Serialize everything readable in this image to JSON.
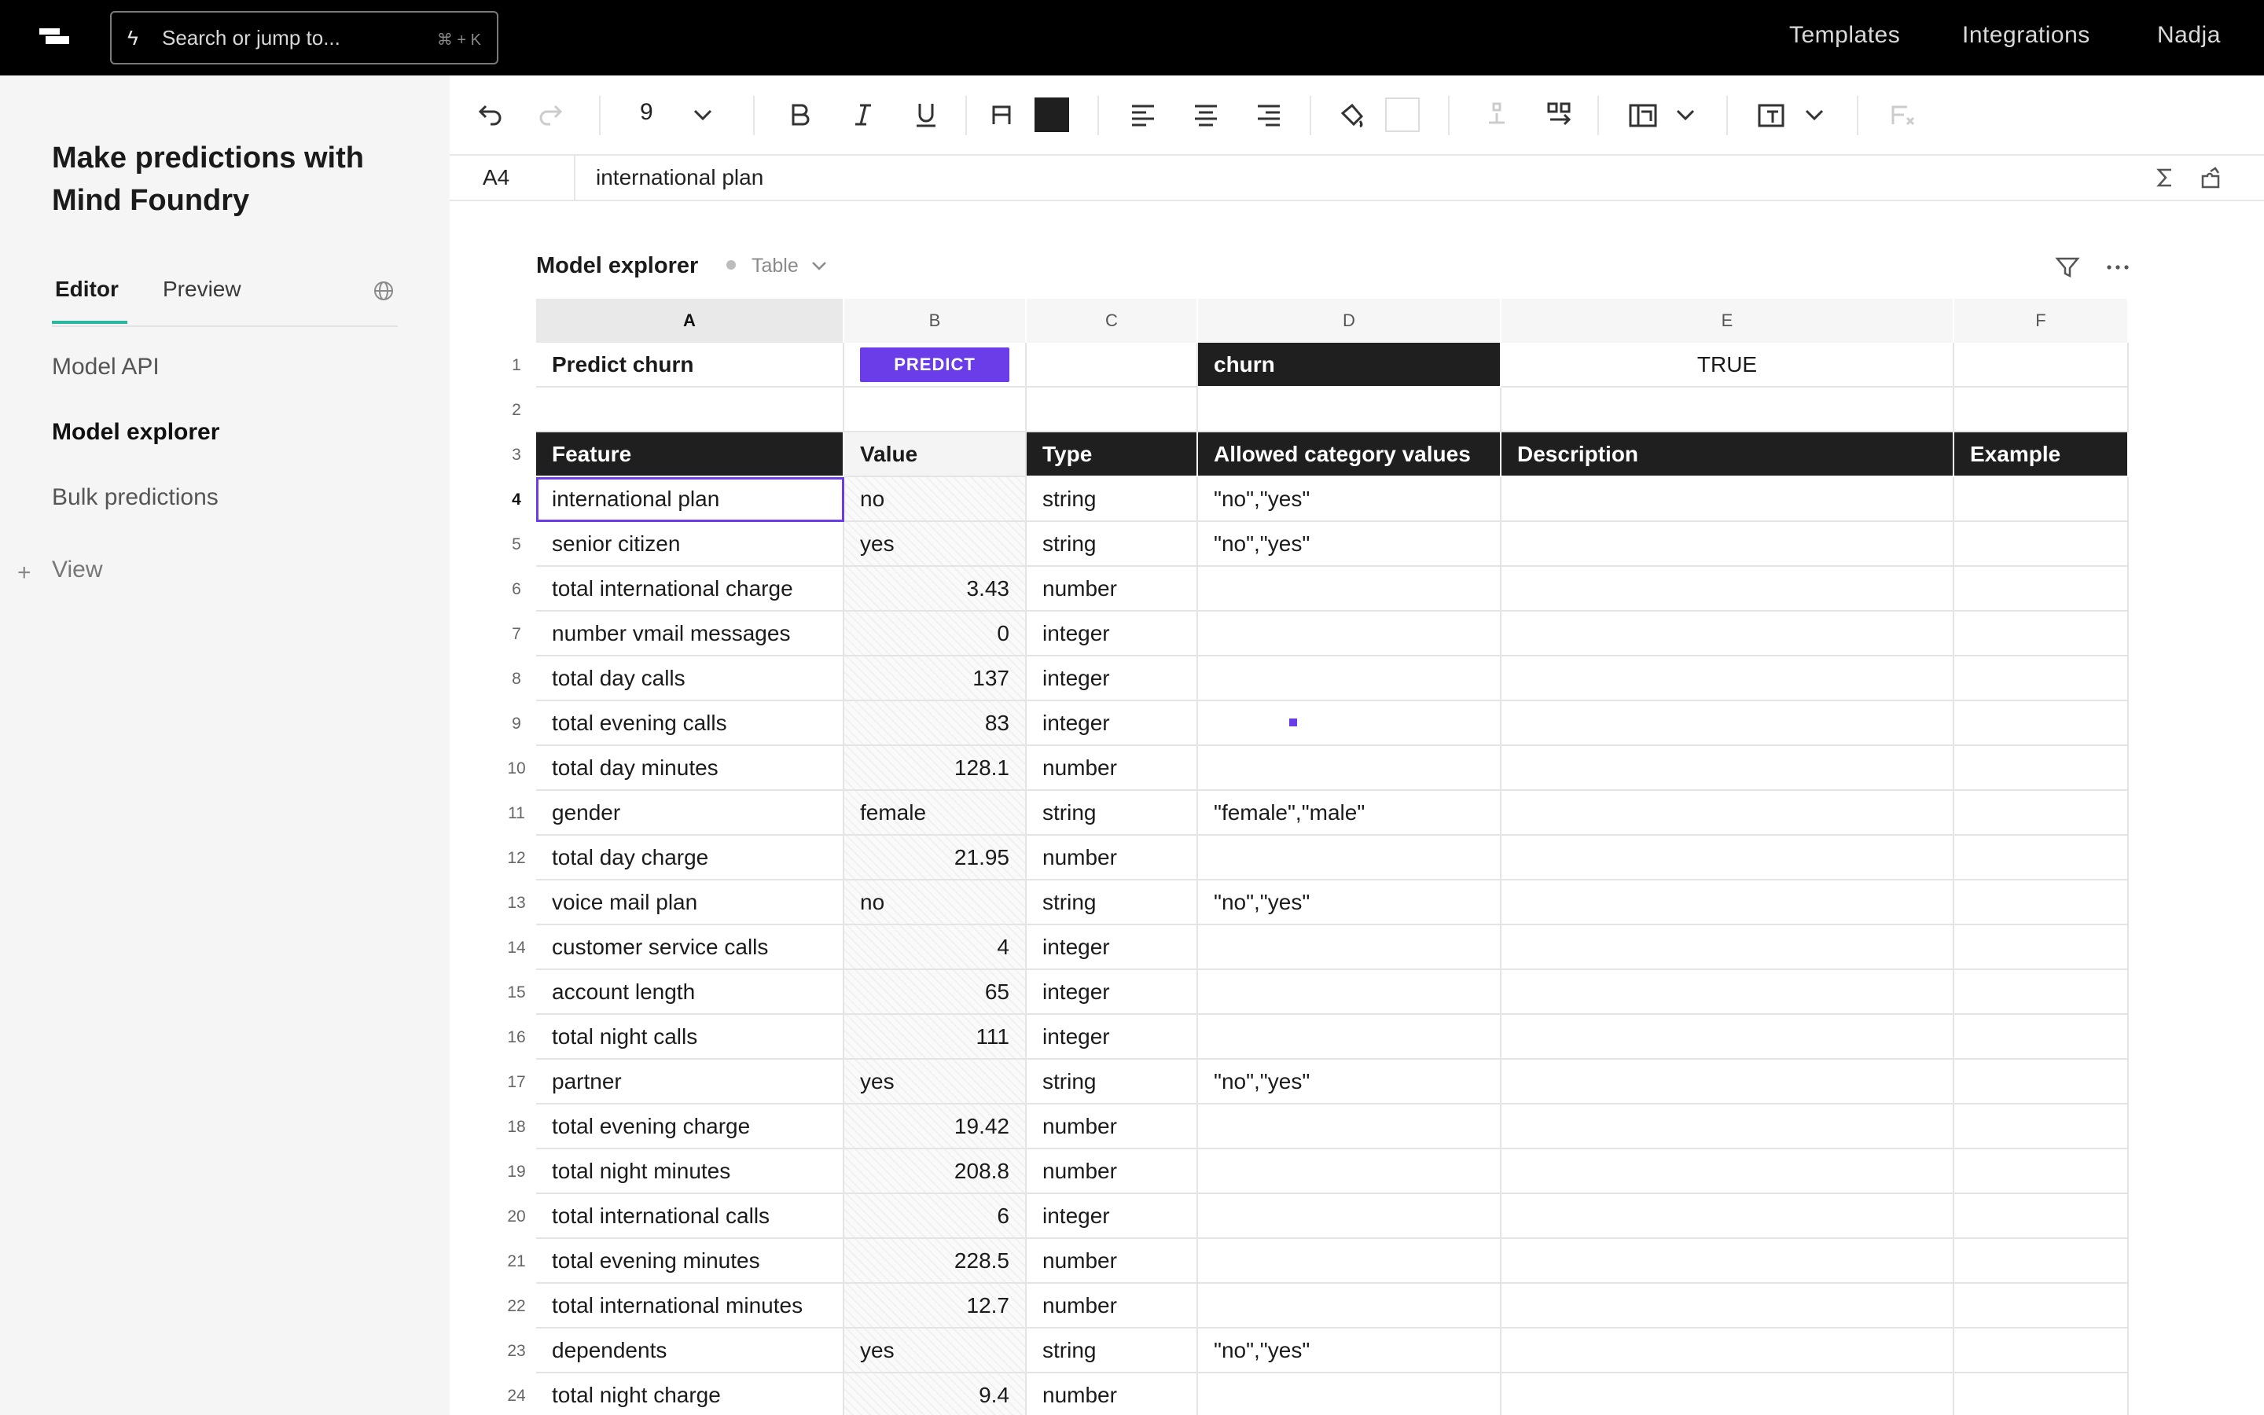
{
  "topbar": {
    "search_placeholder": "Search or jump to...",
    "search_shortcut": "⌘ + K",
    "links": [
      "Templates",
      "Integrations",
      "Nadja"
    ]
  },
  "sidebar": {
    "doc_title": "Make predictions with Mind Foundry",
    "tabs": {
      "editor": "Editor",
      "preview": "Preview"
    },
    "items": [
      {
        "label": "Model API",
        "active": false
      },
      {
        "label": "Model explorer",
        "active": true
      },
      {
        "label": "Bulk predictions",
        "active": false
      }
    ],
    "add_view_label": "View",
    "accent": "#2bb69e"
  },
  "toolbar": {
    "font_size": "9",
    "icons": [
      "undo-icon",
      "redo-icon",
      "font-size-dropdown-icon",
      "bold-icon",
      "italic-icon",
      "underline-icon",
      "text-color-icon",
      "text-color-swatch",
      "align-left-icon",
      "align-center-icon",
      "align-right-icon",
      "fill-color-icon",
      "fill-color-swatch",
      "insert-row-icon",
      "insert-column-icon",
      "merge-cells-icon",
      "text-wrap-icon",
      "clear-format-icon"
    ]
  },
  "formula_bar": {
    "cell_ref": "A4",
    "content": "international plan"
  },
  "table": {
    "title": "Model explorer",
    "view_type": "Table",
    "columns": [
      "A",
      "B",
      "C",
      "D",
      "E",
      "F"
    ],
    "header_row": {
      "predict_label": "Predict churn",
      "predict_button": "PREDICT",
      "target_label": "churn",
      "target_value": "TRUE"
    },
    "field_headers": [
      "Feature",
      "Value",
      "Type",
      "Allowed category values",
      "Description",
      "Example"
    ],
    "rows": [
      {
        "n": "4",
        "feature": "international plan",
        "value": "no",
        "type": "string",
        "allowed": "\"no\",\"yes\"",
        "numeric": false
      },
      {
        "n": "5",
        "feature": "senior citizen",
        "value": "yes",
        "type": "string",
        "allowed": "\"no\",\"yes\"",
        "numeric": false
      },
      {
        "n": "6",
        "feature": "total international charge",
        "value": "3.43",
        "type": "number",
        "allowed": "",
        "numeric": true
      },
      {
        "n": "7",
        "feature": "number vmail messages",
        "value": "0",
        "type": "integer",
        "allowed": "",
        "numeric": true
      },
      {
        "n": "8",
        "feature": "total day calls",
        "value": "137",
        "type": "integer",
        "allowed": "",
        "numeric": true
      },
      {
        "n": "9",
        "feature": "total evening calls",
        "value": "83",
        "type": "integer",
        "allowed": "",
        "numeric": true
      },
      {
        "n": "10",
        "feature": "total day minutes",
        "value": "128.1",
        "type": "number",
        "allowed": "",
        "numeric": true
      },
      {
        "n": "11",
        "feature": "gender",
        "value": "female",
        "type": "string",
        "allowed": "\"female\",\"male\"",
        "numeric": false
      },
      {
        "n": "12",
        "feature": "total day charge",
        "value": "21.95",
        "type": "number",
        "allowed": "",
        "numeric": true
      },
      {
        "n": "13",
        "feature": "voice mail plan",
        "value": "no",
        "type": "string",
        "allowed": "\"no\",\"yes\"",
        "numeric": false
      },
      {
        "n": "14",
        "feature": "customer service calls",
        "value": "4",
        "type": "integer",
        "allowed": "",
        "numeric": true
      },
      {
        "n": "15",
        "feature": "account length",
        "value": "65",
        "type": "integer",
        "allowed": "",
        "numeric": true
      },
      {
        "n": "16",
        "feature": "total night calls",
        "value": "111",
        "type": "integer",
        "allowed": "",
        "numeric": true
      },
      {
        "n": "17",
        "feature": "partner",
        "value": "yes",
        "type": "string",
        "allowed": "\"no\",\"yes\"",
        "numeric": false
      },
      {
        "n": "18",
        "feature": "total evening charge",
        "value": "19.42",
        "type": "number",
        "allowed": "",
        "numeric": true
      },
      {
        "n": "19",
        "feature": "total night minutes",
        "value": "208.8",
        "type": "number",
        "allowed": "",
        "numeric": true
      },
      {
        "n": "20",
        "feature": "total international calls",
        "value": "6",
        "type": "integer",
        "allowed": "",
        "numeric": true
      },
      {
        "n": "21",
        "feature": "total evening minutes",
        "value": "228.5",
        "type": "number",
        "allowed": "",
        "numeric": true
      },
      {
        "n": "22",
        "feature": "total international minutes",
        "value": "12.7",
        "type": "number",
        "allowed": "",
        "numeric": true
      },
      {
        "n": "23",
        "feature": "dependents",
        "value": "yes",
        "type": "string",
        "allowed": "\"no\",\"yes\"",
        "numeric": false
      },
      {
        "n": "24",
        "feature": "total night charge",
        "value": "9.4",
        "type": "number",
        "allowed": "",
        "numeric": true
      }
    ],
    "colors": {
      "accent": "#6a3de8",
      "header_bg": "#1f1f1f"
    }
  }
}
